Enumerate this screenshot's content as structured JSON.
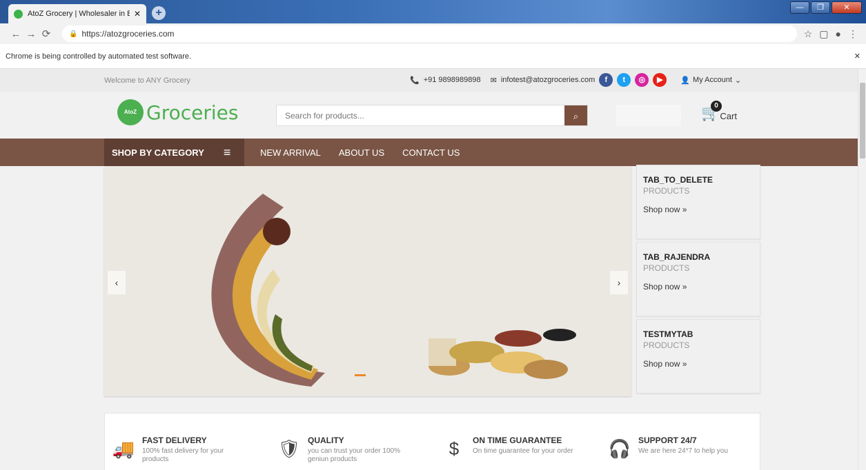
{
  "browser": {
    "tab_title": "AtoZ Grocery | Wholesaler in Ban",
    "tab_close": "✕",
    "new_tab": "+",
    "url": "https://atozgroceries.com",
    "infobar_text": "Chrome is being controlled by automated test software.",
    "infobar_close": "✕",
    "minimize": "—",
    "maximize": "❐",
    "close": "✕"
  },
  "top": {
    "welcome": "Welcome to ANY Grocery",
    "phone": "+91 9898989898",
    "email": "infotest@atozgroceries.com",
    "my_account": "My Account"
  },
  "header": {
    "logo_badge": "AtoZ",
    "logo_text": "Groceries",
    "search_placeholder": "Search for products...",
    "cart_count": "0",
    "cart_label": "Cart"
  },
  "nav": {
    "shop_by_category": "SHOP BY CATEGORY",
    "links": [
      "NEW ARRIVAL",
      "ABOUT US",
      "CONTACT US"
    ]
  },
  "slider": {
    "prev": "‹",
    "next": "›"
  },
  "sidetabs": [
    {
      "title": "TAB_TO_DELETE",
      "subtitle": "PRODUCTS",
      "link": "Shop now »"
    },
    {
      "title": "TAB_RAJENDRA",
      "subtitle": "PRODUCTS",
      "link": "Shop now »"
    },
    {
      "title": "TESTMYTAB",
      "subtitle": "PRODUCTS",
      "link": "Shop now »"
    }
  ],
  "features": [
    {
      "title": "FAST DELIVERY",
      "desc": "100% fast delivery for your products",
      "icon": "truck-icon"
    },
    {
      "title": "QUALITY",
      "desc": "you can trust your order 100% geniun products",
      "icon": "shield-check-icon"
    },
    {
      "title": "ON TIME GUARANTEE",
      "desc": "On time guarantee for your order",
      "icon": "dollar-refresh-icon"
    },
    {
      "title": "SUPPORT 24/7",
      "desc": "We are here 24*7 to help you",
      "icon": "headset-icon"
    }
  ],
  "colors": {
    "brand_green": "#4caf50",
    "nav_brown": "#7a5545",
    "nav_dark_brown": "#5f3f33",
    "accent_orange": "#e88a2a"
  }
}
